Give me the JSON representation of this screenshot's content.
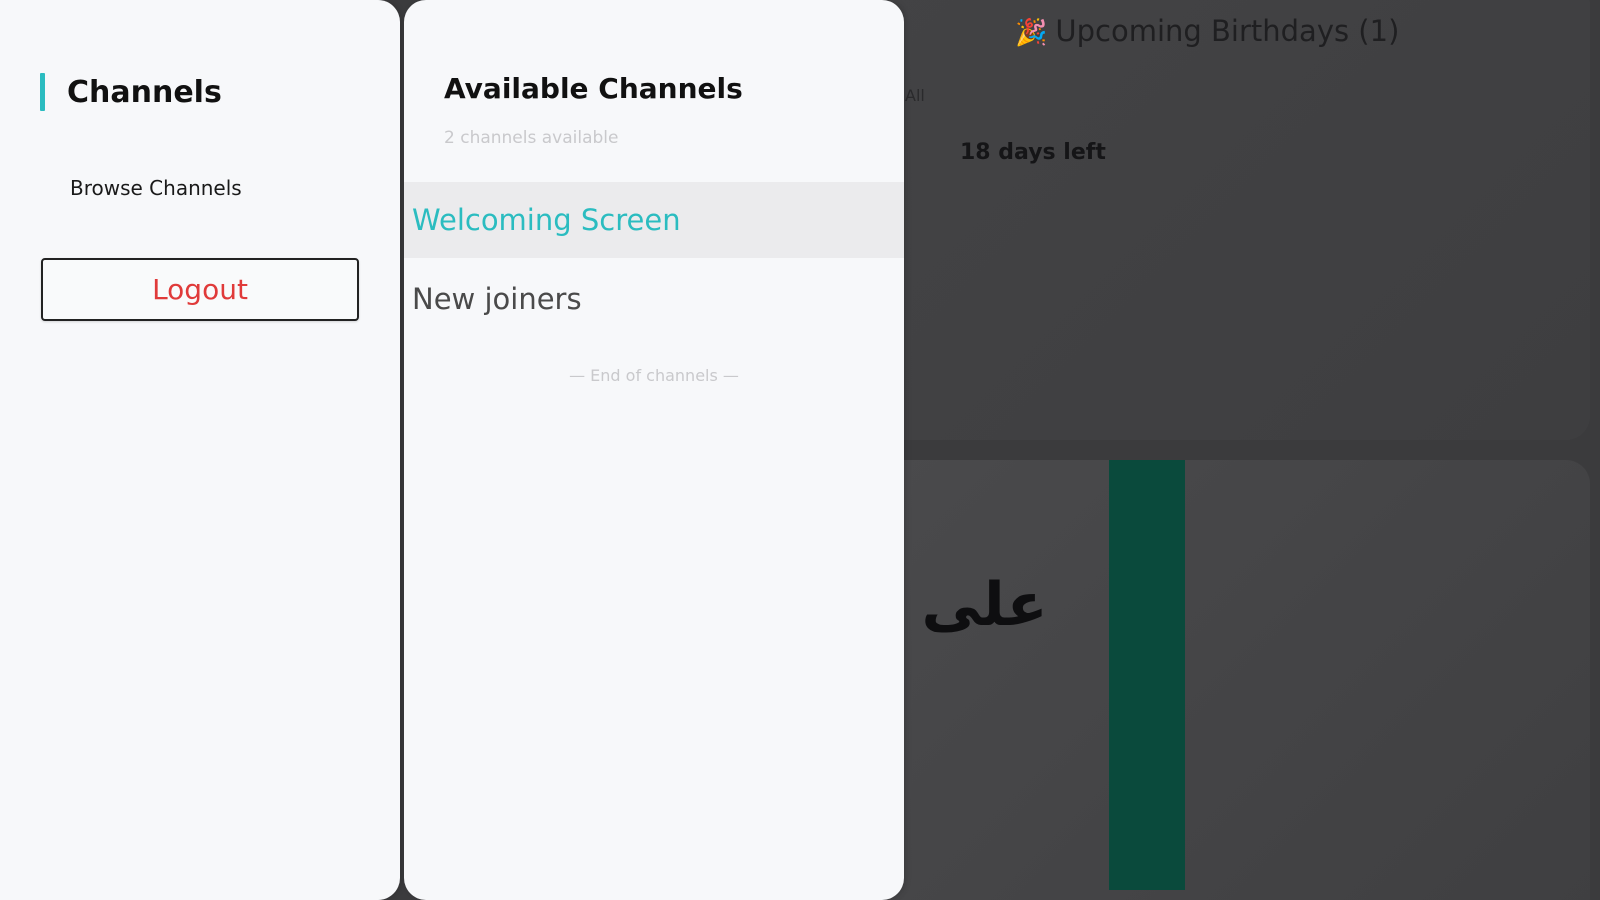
{
  "background": {
    "birthdays_title": "Upcoming Birthdays (1)",
    "birthdays_icon": "🎉",
    "filter_label": "All",
    "days_left": "18 days left",
    "arabic_text": "على ا"
  },
  "sidebar": {
    "title": "Channels",
    "browse_label": "Browse Channels",
    "logout_label": "Logout"
  },
  "channels_panel": {
    "title": "Available Channels",
    "subtitle": "2 channels available",
    "items": [
      {
        "label": "Welcoming Screen",
        "active": true
      },
      {
        "label": "New joiners",
        "active": false
      }
    ],
    "end_label": "— End of channels —"
  },
  "colors": {
    "accent": "#2bbcc0",
    "logout_text": "#e03a3a",
    "dark_green": "#0a4a3c"
  }
}
